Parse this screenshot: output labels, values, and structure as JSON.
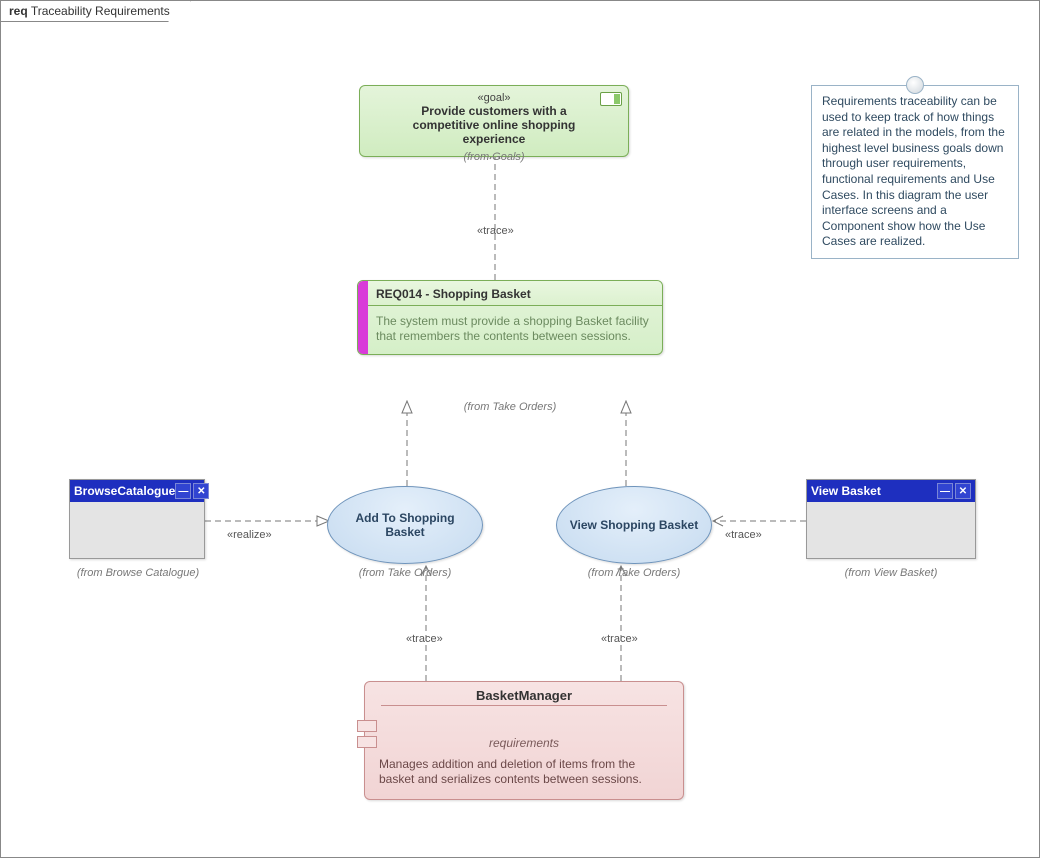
{
  "frame": {
    "prefix": "req",
    "title": "Traceability Requirements"
  },
  "goal": {
    "stereotype": "«goal»",
    "title": "Provide customers with a competitive online shopping experience",
    "from": "(from Goals)"
  },
  "requirement": {
    "id_title": "REQ014 - Shopping Basket",
    "text": "The system must provide a shopping Basket facility that remembers the contents between sessions.",
    "from": "(from Take Orders)"
  },
  "usecases": {
    "add": {
      "label": "Add To Shopping Basket",
      "from": "(from Take Orders)"
    },
    "view": {
      "label": "View Shopping Basket",
      "from": "(from Take Orders)"
    }
  },
  "screens": {
    "browse": {
      "title": "BrowseCatalogue",
      "from": "(from Browse Catalogue)"
    },
    "viewbasket": {
      "title": "View Basket",
      "from": "(from View Basket)"
    }
  },
  "component": {
    "title": "BasketManager",
    "section": "requirements",
    "text": "Manages addition and deletion of items from the basket and serializes contents between sessions."
  },
  "note": {
    "text": "Requirements traceability can be used to keep track of how things are related in the models, from the highest level business goals down through user requirements, functional requirements and Use Cases.  In this diagram the user interface screens and a Component show how the Use Cases are realized."
  },
  "labels": {
    "trace": "«trace»",
    "realize": "«realize»"
  }
}
